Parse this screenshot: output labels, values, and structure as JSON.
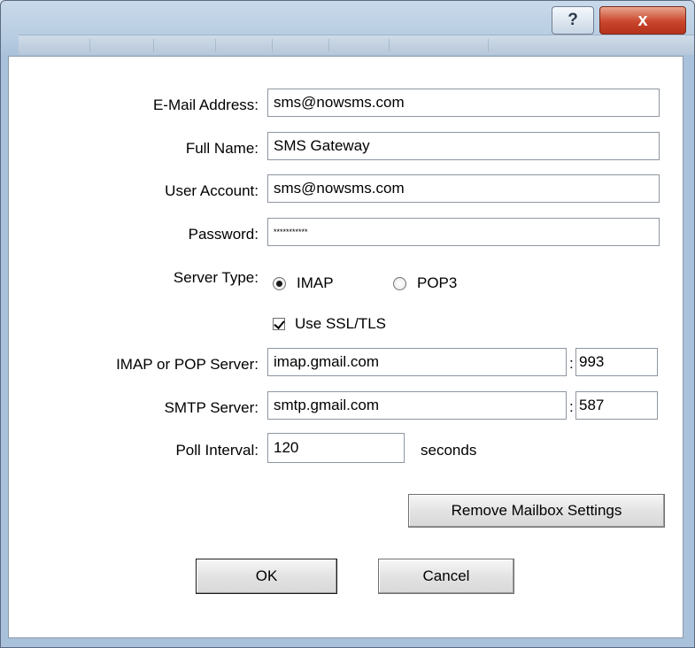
{
  "titlebar": {
    "help_label": "?",
    "close_label": "x"
  },
  "form": {
    "email_label": "E-Mail Address:",
    "email_value": "sms@nowsms.com",
    "fullname_label": "Full Name:",
    "fullname_value": "SMS Gateway",
    "account_label": "User Account:",
    "account_value": "sms@nowsms.com",
    "password_label": "Password:",
    "password_value": "***********",
    "server_type_label": "Server Type:",
    "server_type_options": [
      "IMAP",
      "POP3"
    ],
    "server_type_selected": "IMAP",
    "ssl_label": "Use SSL/TLS",
    "ssl_checked": true,
    "imap_label": "IMAP or POP Server:",
    "imap_value": "imap.gmail.com",
    "imap_port": "993",
    "smtp_label": "SMTP Server:",
    "smtp_value": "smtp.gmail.com",
    "smtp_port": "587",
    "poll_label": "Poll Interval:",
    "poll_value": "120",
    "poll_unit": "seconds",
    "port_separator": ":"
  },
  "buttons": {
    "remove_label": "Remove Mailbox Settings",
    "ok_label": "OK",
    "cancel_label": "Cancel"
  }
}
